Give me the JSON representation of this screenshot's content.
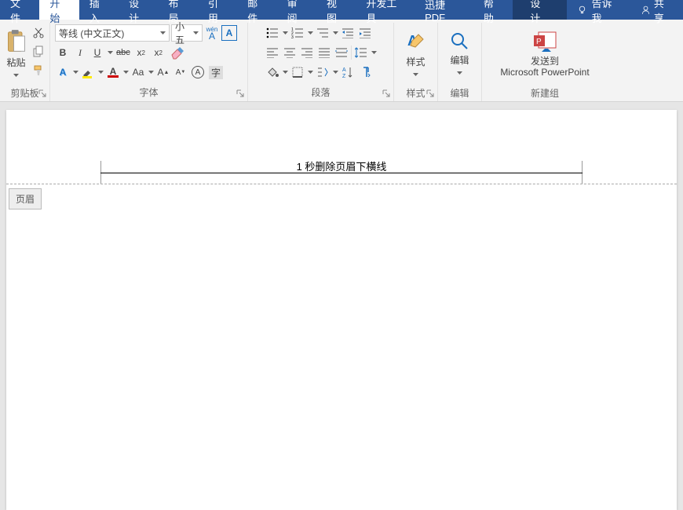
{
  "tabs": {
    "file": "文件",
    "home": "开始",
    "insert": "插入",
    "design": "设计",
    "layout": "布局",
    "ref": "引用",
    "mail": "邮件",
    "review": "审阅",
    "view": "视图",
    "dev": "开发工具",
    "pdf": "迅捷PDF",
    "help": "帮助",
    "design2": "设计",
    "tell": "告诉我",
    "share": "共享"
  },
  "ribbon": {
    "clipboard": {
      "label": "剪贴板",
      "paste": "粘贴"
    },
    "font": {
      "label": "字体",
      "name": "等线 (中文正文)",
      "size": "小五",
      "py": "wén",
      "frame": "A"
    },
    "para": {
      "label": "段落"
    },
    "styles": {
      "label": "样式",
      "btn": "样式"
    },
    "edit": {
      "label": "编辑",
      "btn": "编辑"
    },
    "new": {
      "label": "新建组",
      "send1": "发送到",
      "send2": "Microsoft PowerPoint"
    }
  },
  "doc": {
    "headerText": "1 秒删除页眉下横线",
    "headerTab": "页眉"
  }
}
